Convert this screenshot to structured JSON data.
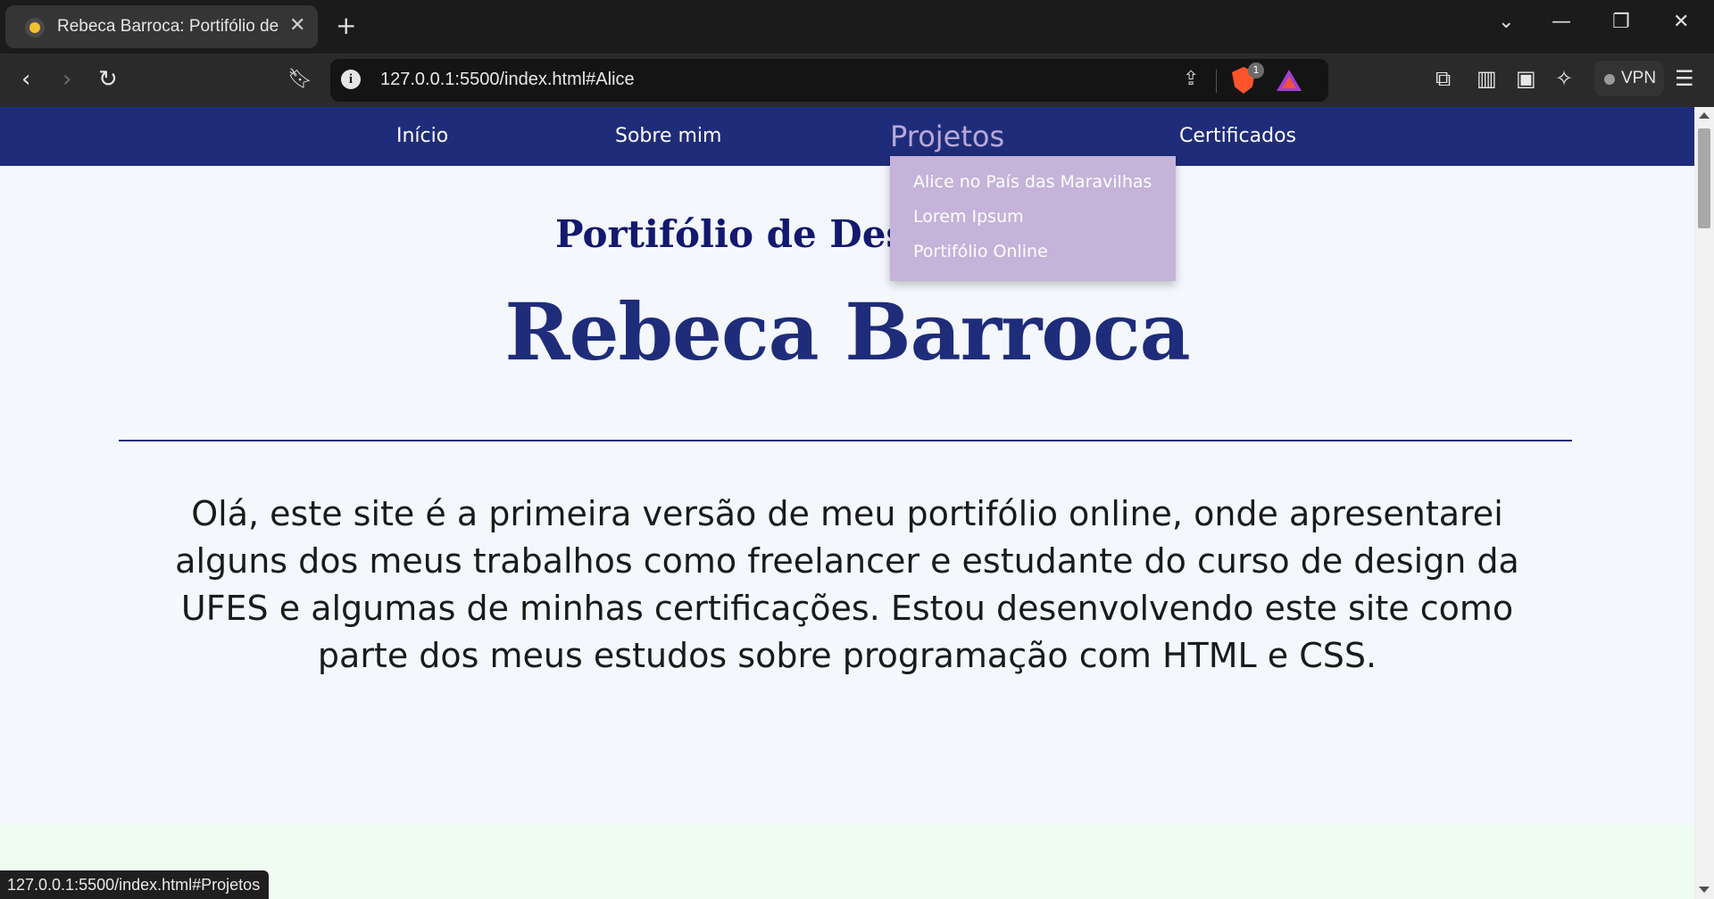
{
  "browser": {
    "tab_title": "Rebeca Barroca: Portifólio de Design",
    "tab_close": "✕",
    "new_tab": "+",
    "url": "127.0.0.1:5500/index.html#Alice",
    "shields_badge": "1",
    "vpn_label": "VPN",
    "status_url": "127.0.0.1:5500/index.html#Projetos"
  },
  "site": {
    "nav": {
      "items": [
        {
          "label": "Início"
        },
        {
          "label": "Sobre mim"
        },
        {
          "label": "Projetos"
        },
        {
          "label": "Certificados"
        }
      ],
      "dropdown": [
        {
          "label": "Alice no País das Maravilhas"
        },
        {
          "label": "Lorem Ipsum"
        },
        {
          "label": "Portifólio Online"
        }
      ]
    },
    "subtitle": "Portifólio de Design",
    "name": "Rebeca Barroca",
    "intro": "Olá, este site é a primeira versão de meu portifólio online, onde apresentarei alguns dos meus trabalhos como freelancer e estudante do curso de design da UFES e algumas de minhas certificações. Estou desenvolvendo este site como parte dos meus estudos sobre programação com HTML e CSS."
  },
  "colors": {
    "nav_bg": "#1f2c7a",
    "dropdown_bg": "#c5b3da",
    "heading": "#1f2c7a",
    "page_bg": "#f4f8fc"
  }
}
